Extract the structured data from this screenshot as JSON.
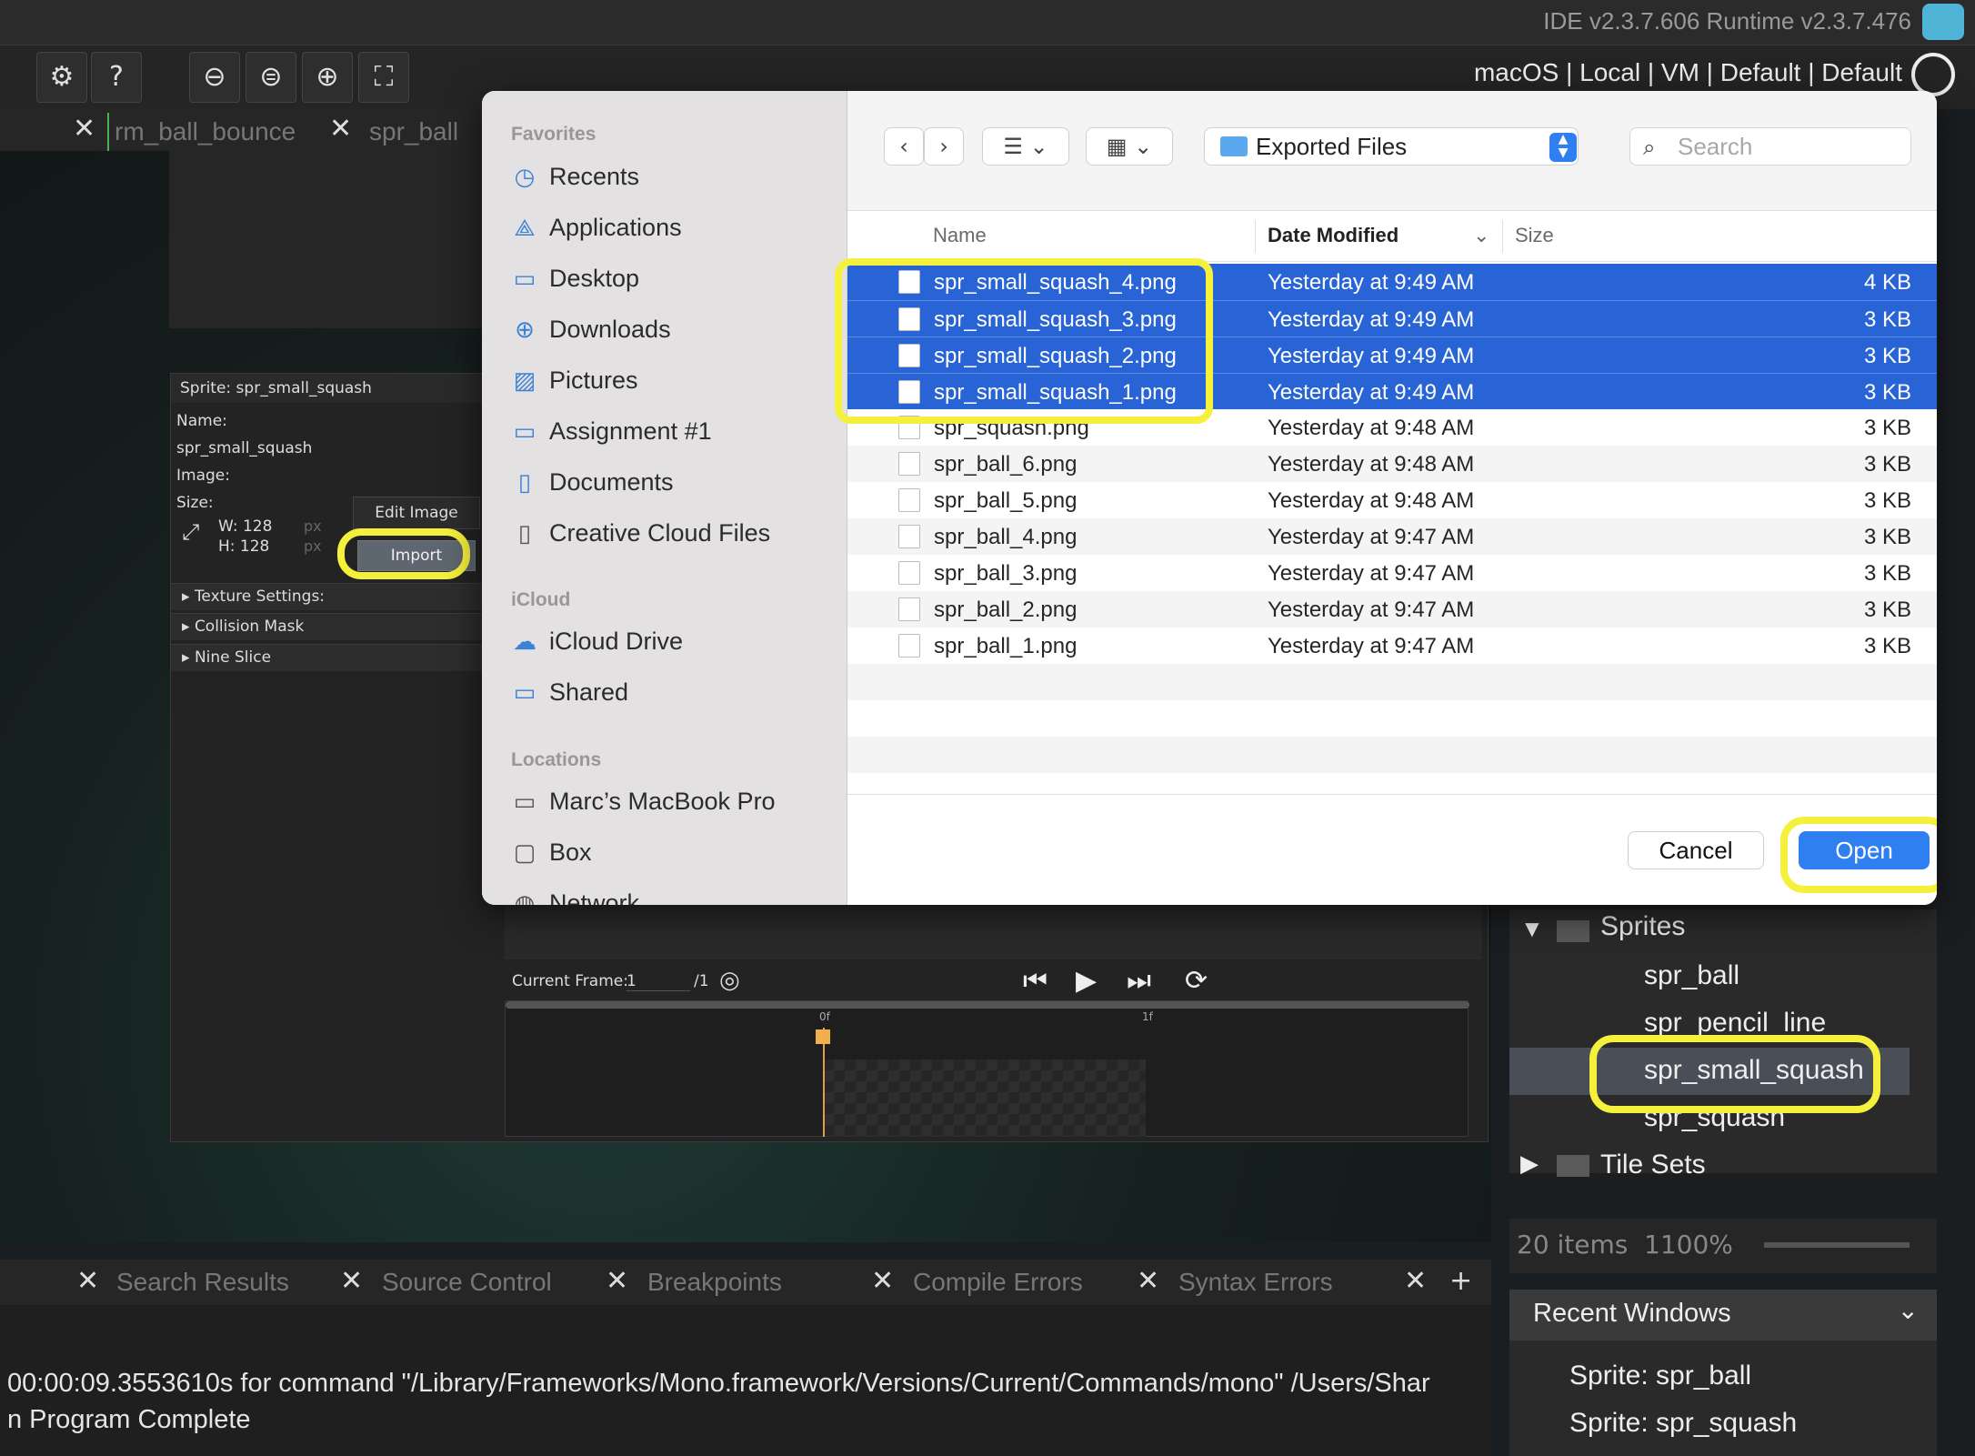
{
  "ide": {
    "version_text": "IDE v2.3.7.606  Runtime v2.3.7.476",
    "target_info": "macOS | Local | VM | Default | Default",
    "tabs": [
      {
        "label": "rm_ball_bounce"
      },
      {
        "label": "spr_ball"
      }
    ]
  },
  "sprite_editor": {
    "title": "Sprite: spr_small_squash",
    "name_label": "Name:",
    "name_value": "spr_small_squash",
    "image_label": "Image:",
    "size_label": "Size:",
    "width_text": "W: 128",
    "height_text": "H: 128",
    "unit": "px",
    "edit_image_label": "Edit Image",
    "import_label": "Import",
    "sections": [
      "Texture Settings:",
      "Collision Mask",
      "Nine Slice"
    ],
    "current_frame_label": "Current Frame:",
    "current_frame_value": "1",
    "frame_total": "/1",
    "timeline_ticks": [
      "0f",
      "1f"
    ]
  },
  "asset_browser": {
    "group": "Sprites",
    "items": [
      "spr_ball",
      "spr_pencil_line",
      "spr_small_squash",
      "spr_squash"
    ],
    "tile_sets": "Tile Sets",
    "item_count": "20 items",
    "zoom": "1100%",
    "recent_header": "Recent Windows",
    "recent_items": [
      "Sprite: spr_ball",
      "Sprite: spr_squash"
    ]
  },
  "output": {
    "tabs": [
      "Search Results",
      "Source Control",
      "Breakpoints",
      "Compile Errors",
      "Syntax Errors"
    ],
    "line1": "00:00:09.3553610s for command \"/Library/Frameworks/Mono.framework/Versions/Current/Commands/mono\" /Users/Shar",
    "line2": "n Program Complete"
  },
  "dialog": {
    "favorites_header": "Favorites",
    "favorites": [
      {
        "label": "Recents",
        "icon": "clock-icon"
      },
      {
        "label": "Applications",
        "icon": "applications-icon"
      },
      {
        "label": "Desktop",
        "icon": "desktop-icon"
      },
      {
        "label": "Downloads",
        "icon": "download-icon"
      },
      {
        "label": "Pictures",
        "icon": "pictures-icon"
      },
      {
        "label": "Assignment #1",
        "icon": "folder-icon"
      },
      {
        "label": "Documents",
        "icon": "document-icon"
      },
      {
        "label": "Creative Cloud Files",
        "icon": "file-icon"
      }
    ],
    "icloud_header": "iCloud",
    "icloud": [
      {
        "label": "iCloud Drive",
        "icon": "cloud-icon"
      },
      {
        "label": "Shared",
        "icon": "shared-folder-icon"
      }
    ],
    "locations_header": "Locations",
    "locations": [
      {
        "label": "Marc’s MacBook Pro",
        "icon": "laptop-icon"
      },
      {
        "label": "Box",
        "icon": "box-icon"
      },
      {
        "label": "Network",
        "icon": "network-icon"
      }
    ],
    "current_folder": "Exported Files",
    "search_placeholder": "Search",
    "columns": {
      "name": "Name",
      "date": "Date Modified",
      "size": "Size"
    },
    "files": [
      {
        "name": "spr_small_squash_4.png",
        "date": "Yesterday at 9:49 AM",
        "size": "4 KB",
        "selected": true
      },
      {
        "name": "spr_small_squash_3.png",
        "date": "Yesterday at 9:49 AM",
        "size": "3 KB",
        "selected": true
      },
      {
        "name": "spr_small_squash_2.png",
        "date": "Yesterday at 9:49 AM",
        "size": "3 KB",
        "selected": true
      },
      {
        "name": "spr_small_squash_1.png",
        "date": "Yesterday at 9:49 AM",
        "size": "3 KB",
        "selected": true
      },
      {
        "name": "spr_squash.png",
        "date": "Yesterday at 9:48 AM",
        "size": "3 KB",
        "selected": false
      },
      {
        "name": "spr_ball_6.png",
        "date": "Yesterday at 9:48 AM",
        "size": "3 KB",
        "selected": false
      },
      {
        "name": "spr_ball_5.png",
        "date": "Yesterday at 9:48 AM",
        "size": "3 KB",
        "selected": false
      },
      {
        "name": "spr_ball_4.png",
        "date": "Yesterday at 9:47 AM",
        "size": "3 KB",
        "selected": false
      },
      {
        "name": "spr_ball_3.png",
        "date": "Yesterday at 9:47 AM",
        "size": "3 KB",
        "selected": false
      },
      {
        "name": "spr_ball_2.png",
        "date": "Yesterday at 9:47 AM",
        "size": "3 KB",
        "selected": false
      },
      {
        "name": "spr_ball_1.png",
        "date": "Yesterday at 9:47 AM",
        "size": "3 KB",
        "selected": false
      }
    ],
    "cancel_label": "Cancel",
    "open_label": "Open"
  },
  "colors": {
    "selection_blue": "#2964d6",
    "highlight_yellow": "#f5f03b",
    "open_button": "#2f7ff0"
  }
}
